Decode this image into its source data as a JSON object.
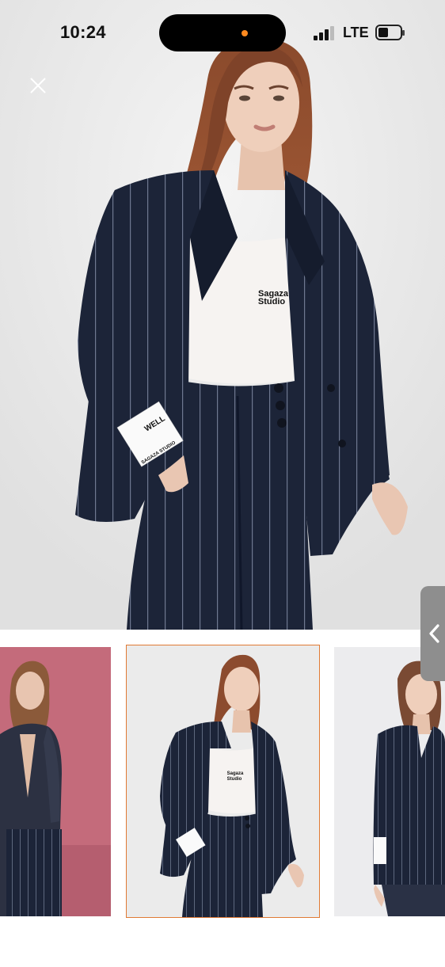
{
  "status_bar": {
    "time": "10:24",
    "network": "LTE",
    "signal_icon": "cellular-signal-icon",
    "battery_icon": "battery-icon"
  },
  "viewer": {
    "close_icon": "close-icon",
    "handle_icon": "chevron-left-icon",
    "accent_color": "#e07a34"
  },
  "main_image": {
    "shirt_print_line1": "Sagaza",
    "shirt_print_line2": "Studio",
    "cuff_label_word": "WELL",
    "cuff_label_brand": "SAGAZA STUDIO"
  },
  "thumbnails": [
    {
      "name": "thumbnail-1",
      "selected": false
    },
    {
      "name": "thumbnail-2",
      "selected": true,
      "shirt_print_line1": "Sagaza",
      "shirt_print_line2": "Studio"
    },
    {
      "name": "thumbnail-3",
      "selected": false
    }
  ]
}
